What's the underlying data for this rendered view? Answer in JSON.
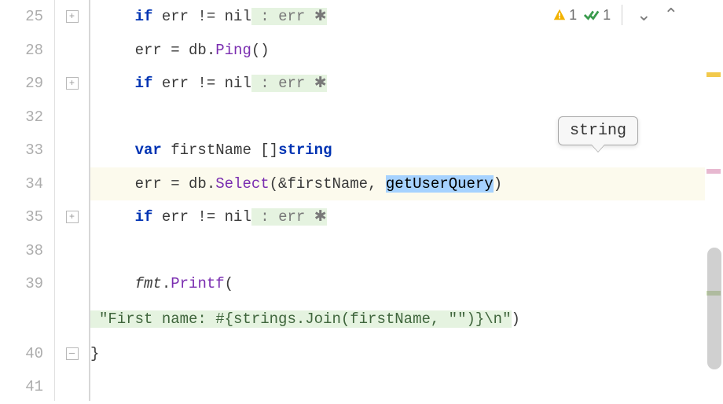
{
  "inspections": {
    "warning_count": "1",
    "weak_warning_count": "1"
  },
  "tooltip": {
    "text": "string"
  },
  "lines": {
    "l25": {
      "number": "25",
      "kw_if": "if",
      "cond": "err != nil",
      "hint_colon": " : ",
      "hint_var": "err",
      "hint_tail": " ✱"
    },
    "l28": {
      "number": "28",
      "lhs": "err = db.",
      "call": "Ping",
      "tail": "()"
    },
    "l29": {
      "number": "29",
      "kw_if": "if",
      "cond": "err != nil",
      "hint_colon": " : ",
      "hint_var": "err",
      "hint_tail": " ✱"
    },
    "l32": {
      "number": "32"
    },
    "l33": {
      "number": "33",
      "kw_var": "var",
      "name": " firstName []",
      "type": "string"
    },
    "l34": {
      "number": "34",
      "lhs": "err = db.",
      "call": "Select",
      "mid": "(&firstName, ",
      "sel": "getUserQuery",
      "tail": ")"
    },
    "l35": {
      "number": "35",
      "kw_if": "if",
      "cond": "err != nil",
      "hint_colon": " : ",
      "hint_var": "err",
      "hint_tail": " ✱"
    },
    "l38": {
      "number": "38"
    },
    "l39": {
      "number": "39",
      "pkg": "fmt",
      "dot": ".",
      "call": "Printf",
      "open": "(",
      "string_line": "\"First name: #{strings.Join(firstName, \"\")}\\n\"",
      "close": ")"
    },
    "l40": {
      "number": "40",
      "brace": "}"
    },
    "l41": {
      "number": "41"
    }
  }
}
